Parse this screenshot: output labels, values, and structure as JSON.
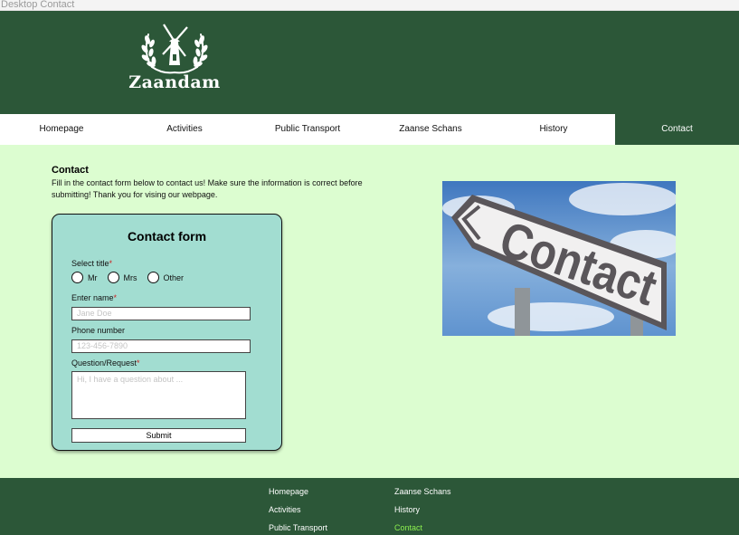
{
  "window": {
    "title": "Desktop Contact"
  },
  "brand": {
    "name": "Zaandam"
  },
  "nav": {
    "items": [
      {
        "label": "Homepage",
        "active": false
      },
      {
        "label": "Activities",
        "active": false
      },
      {
        "label": "Public Transport",
        "active": false
      },
      {
        "label": "Zaanse Schans",
        "active": false
      },
      {
        "label": "History",
        "active": false
      },
      {
        "label": "Contact",
        "active": true
      }
    ]
  },
  "intro": {
    "title": "Contact",
    "text": "Fill in the contact form below to contact us! Make sure the information is correct before submitting! Thank you for vising our webpage."
  },
  "form": {
    "title": "Contact form",
    "title_label": "Select title",
    "required_marker": "*",
    "options": [
      "Mr",
      "Mrs",
      "Other"
    ],
    "name_label": "Enter name",
    "name_placeholder": "Jane Doe",
    "phone_label": "Phone number",
    "phone_placeholder": "123-456-7890",
    "question_label": "Question/Request",
    "question_placeholder": "Hi, I have a question about ...",
    "submit_label": "Submit"
  },
  "image": {
    "sign_text": "Contact"
  },
  "footer": {
    "links": [
      "Homepage",
      "Activities",
      "Public Transport",
      "Zaanse Schans",
      "History",
      "Contact"
    ],
    "active_link": "Contact"
  },
  "colors": {
    "header_green": "#2c5738",
    "page_background": "#dcfdd0",
    "form_background": "#a2ddd1",
    "required": "#cc2222",
    "footer_active": "#8cf04f"
  }
}
